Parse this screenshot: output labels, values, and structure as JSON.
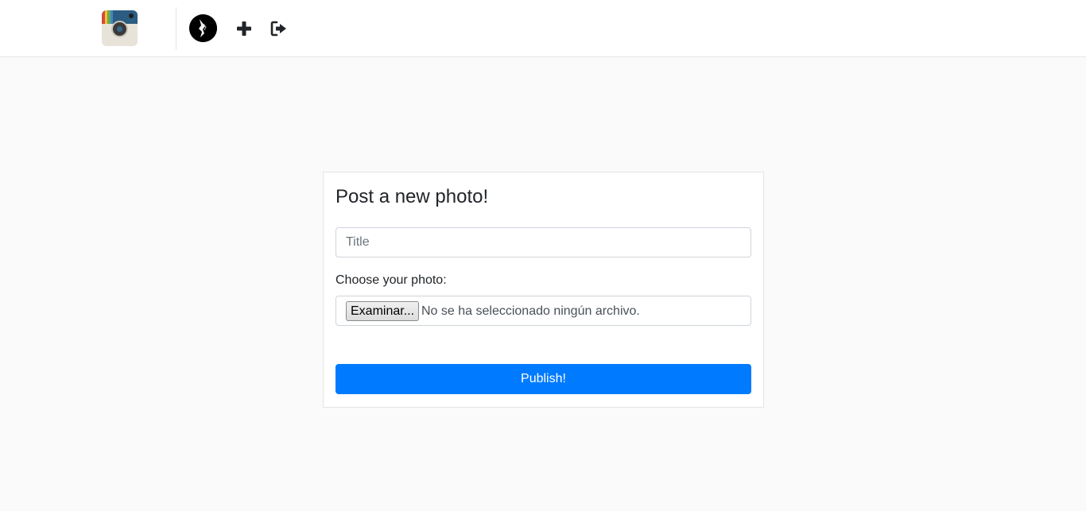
{
  "navbar": {
    "logo_icon": "camera-app-logo-icon",
    "avatar_icon": "user-avatar-icon",
    "add_icon": "plus-icon",
    "logout_icon": "sign-out-icon"
  },
  "form": {
    "heading": "Post a new photo!",
    "title_placeholder": "Title",
    "title_value": "",
    "photo_label": "Choose your photo:",
    "file_button_label": "Examinar...",
    "file_status": "No se ha seleccionado ningún archivo.",
    "submit_label": "Publish!"
  },
  "colors": {
    "primary": "#007bff",
    "page_background": "#fafafa",
    "navbar_background": "#ffffff"
  }
}
